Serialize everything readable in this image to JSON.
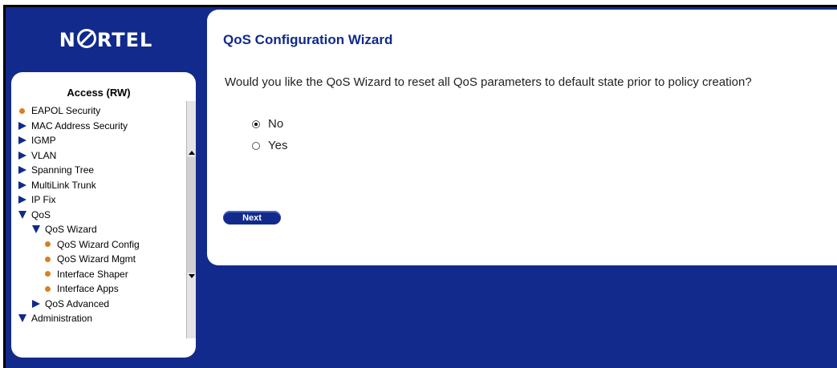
{
  "brand": {
    "logo_text": "NORTEL"
  },
  "nav": {
    "heading": "Access (RW)",
    "items": [
      {
        "label": "EAPOL Security",
        "icon": "bullet",
        "level": 0
      },
      {
        "label": "MAC Address Security",
        "icon": "chevron-right",
        "level": 0
      },
      {
        "label": "IGMP",
        "icon": "chevron-right",
        "level": 0
      },
      {
        "label": "VLAN",
        "icon": "chevron-right",
        "level": 0
      },
      {
        "label": "Spanning Tree",
        "icon": "chevron-right",
        "level": 0
      },
      {
        "label": "MultiLink Trunk",
        "icon": "chevron-right",
        "level": 0
      },
      {
        "label": "IP Fix",
        "icon": "chevron-right",
        "level": 0
      },
      {
        "label": "QoS",
        "icon": "chevron-down",
        "level": 0
      },
      {
        "label": "QoS Wizard",
        "icon": "chevron-down",
        "level": 1
      },
      {
        "label": "QoS Wizard Config",
        "icon": "bullet",
        "level": 2
      },
      {
        "label": "QoS Wizard Mgmt",
        "icon": "bullet",
        "level": 2
      },
      {
        "label": "Interface Shaper",
        "icon": "bullet",
        "level": 2
      },
      {
        "label": "Interface Apps",
        "icon": "bullet",
        "level": 2
      },
      {
        "label": "QoS Advanced",
        "icon": "chevron-right",
        "level": 1
      },
      {
        "label": "Administration",
        "icon": "chevron-down",
        "level": 0
      }
    ]
  },
  "wizard": {
    "title": "QoS Configuration Wizard",
    "question": "Would you like the QoS Wizard to reset all QoS parameters to default state prior to policy creation?",
    "options": [
      {
        "label": "No",
        "checked": true
      },
      {
        "label": "Yes",
        "checked": false
      }
    ],
    "next_label": "Next"
  },
  "colors": {
    "brand_blue": "#112a8c",
    "bullet_orange": "#d88020"
  }
}
